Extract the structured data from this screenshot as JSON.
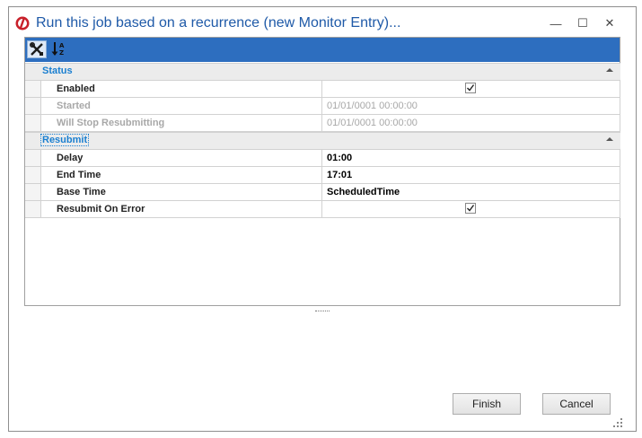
{
  "window": {
    "title": "Run this job based on a recurrence (new Monitor Entry)...",
    "minimize_glyph": "—",
    "maximize_glyph": "☐",
    "close_glyph": "✕"
  },
  "toolbar": {
    "buttons": [
      {
        "icon": "tools-icon",
        "pressed": true
      },
      {
        "icon": "sort-alphabetical-icon",
        "pressed": false
      }
    ]
  },
  "categories": [
    {
      "label": "Status",
      "rows": [
        {
          "name": "Enabled",
          "value": "",
          "checked": true,
          "disabled": false
        },
        {
          "name": "Started",
          "value": "01/01/0001 00:00:00",
          "disabled": true
        },
        {
          "name": "Will Stop Resubmitting",
          "value": "01/01/0001 00:00:00",
          "disabled": true
        }
      ]
    },
    {
      "label": "Resubmit",
      "rows": [
        {
          "name": "Delay",
          "value": "01:00",
          "disabled": false
        },
        {
          "name": "End Time",
          "value": "17:01",
          "disabled": false
        },
        {
          "name": "Base Time",
          "value": "ScheduledTime",
          "disabled": false
        },
        {
          "name": "Resubmit On Error",
          "value": "",
          "checked": true,
          "disabled": false
        }
      ]
    }
  ],
  "buttons": {
    "finish": "Finish",
    "cancel": "Cancel"
  },
  "colors": {
    "title": "#1f5aa8",
    "toolbar": "#2d6ebf",
    "category_text": "#1a7fd0",
    "app_icon": "#c8202a"
  }
}
